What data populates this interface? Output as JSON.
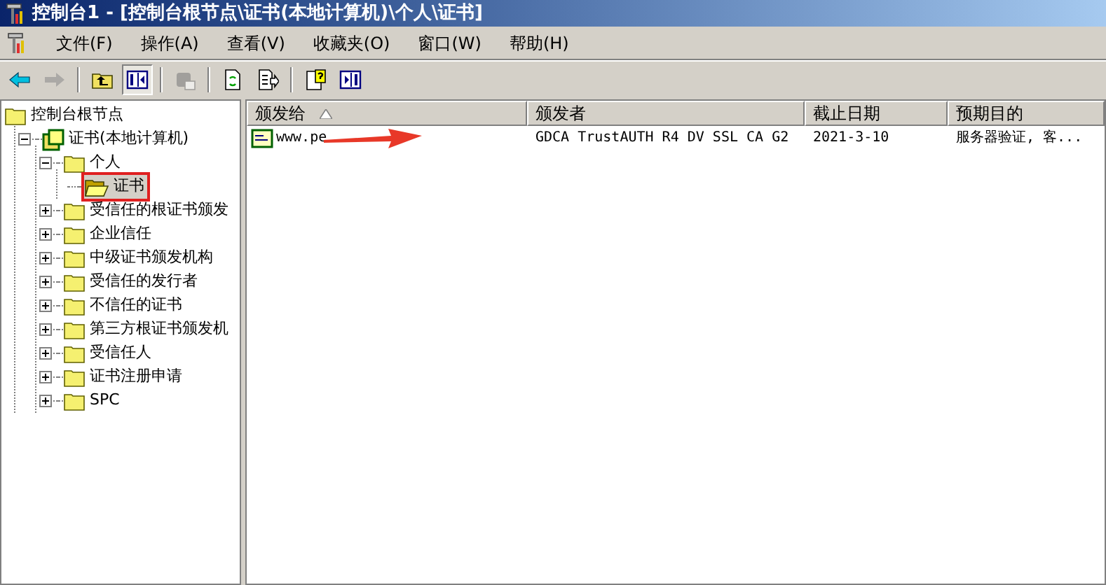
{
  "window": {
    "title": "控制台1 - [控制台根节点\\证书(本地计算机)\\个人\\证书]"
  },
  "menu": [
    "文件(F)",
    "操作(A)",
    "查看(V)",
    "收藏夹(O)",
    "窗口(W)",
    "帮助(H)"
  ],
  "toolbar": [
    {
      "kind": "back",
      "disabled": false,
      "pressed": false
    },
    {
      "kind": "forward",
      "disabled": true,
      "pressed": false
    },
    {
      "kind": "sep"
    },
    {
      "kind": "up",
      "disabled": false,
      "pressed": false
    },
    {
      "kind": "tree",
      "disabled": false,
      "pressed": true
    },
    {
      "kind": "sep"
    },
    {
      "kind": "delete",
      "disabled": true,
      "pressed": false
    },
    {
      "kind": "sep"
    },
    {
      "kind": "refresh",
      "disabled": false,
      "pressed": false
    },
    {
      "kind": "export",
      "disabled": false,
      "pressed": false
    },
    {
      "kind": "sep"
    },
    {
      "kind": "help",
      "disabled": false,
      "pressed": false
    },
    {
      "kind": "pane",
      "disabled": false,
      "pressed": false
    }
  ],
  "tree": [
    {
      "label": "控制台根节点",
      "kind": "folder",
      "selected": false,
      "children": [
        {
          "label": "证书(本地计算机)",
          "kind": "cert",
          "expanded": true,
          "selected": false,
          "children": [
            {
              "label": "个人",
              "kind": "folder",
              "expanded": true,
              "selected": false,
              "children": [
                {
                  "label": "证书",
                  "kind": "open-folder",
                  "selected": true
                }
              ]
            },
            {
              "label": "受信任的根证书颁发",
              "kind": "folder",
              "expanded": false,
              "selected": false
            },
            {
              "label": "企业信任",
              "kind": "folder",
              "expanded": false,
              "selected": false
            },
            {
              "label": "中级证书颁发机构",
              "kind": "folder",
              "expanded": false,
              "selected": false
            },
            {
              "label": "受信任的发行者",
              "kind": "folder",
              "expanded": false,
              "selected": false
            },
            {
              "label": "不信任的证书",
              "kind": "folder",
              "expanded": false,
              "selected": false
            },
            {
              "label": "第三方根证书颁发机",
              "kind": "folder",
              "expanded": false,
              "selected": false
            },
            {
              "label": "受信任人",
              "kind": "folder",
              "expanded": false,
              "selected": false
            },
            {
              "label": "证书注册申请",
              "kind": "folder",
              "expanded": false,
              "selected": false
            },
            {
              "label": "SPC",
              "kind": "folder",
              "expanded": false,
              "selected": false
            }
          ]
        }
      ]
    }
  ],
  "table": {
    "columns": [
      {
        "label": "颁发给",
        "sorted": true
      },
      {
        "label": "颁发者",
        "sorted": false
      },
      {
        "label": "截止日期",
        "sorted": false
      },
      {
        "label": "预期目的",
        "sorted": false
      }
    ],
    "rows": [
      [
        "www.pe",
        "GDCA TrustAUTH R4 DV SSL CA G2",
        "2021-3-10",
        "服务器验证, 客..."
      ]
    ]
  }
}
